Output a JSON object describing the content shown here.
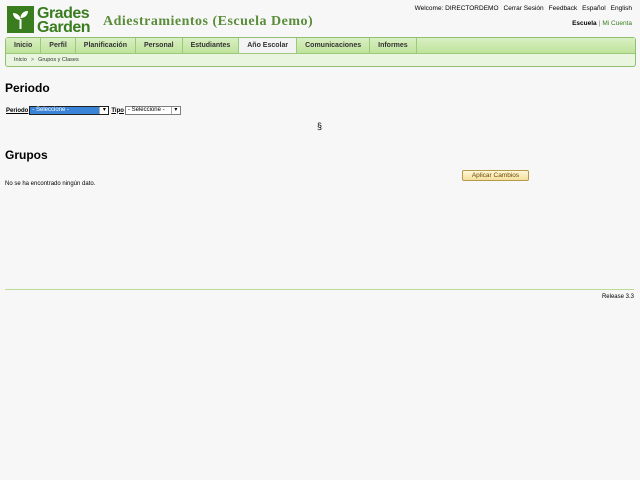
{
  "header": {
    "logo": {
      "line1": "Grades",
      "line2": "Garden"
    },
    "title": "Adiestramientos (Escuela Demo)",
    "top_links": {
      "welcome": "Welcome: DIRECTORDEMO",
      "logout": "Cerrar Sesión",
      "feedback": "Feedback",
      "spanish": "Español",
      "english": "English"
    },
    "scope": {
      "active": "Escuela",
      "separator": "|",
      "other": "Mi Cuenta"
    }
  },
  "nav": {
    "items": [
      {
        "label": "Inicio"
      },
      {
        "label": "Perfil"
      },
      {
        "label": "Planificación"
      },
      {
        "label": "Personal"
      },
      {
        "label": "Estudiantes"
      },
      {
        "label": "Año Escolar"
      },
      {
        "label": "Comunicaciones"
      },
      {
        "label": "Informes"
      }
    ],
    "active_index": 5
  },
  "breadcrumb": {
    "home": "Inicio",
    "separator": ">",
    "current": "Grupos y Clases"
  },
  "periodo_section": {
    "heading": "Periodo",
    "periodo_label": "Periodo",
    "periodo_value": "- Seleccione -",
    "tipo_label": "Tipo",
    "tipo_value": "- Seleccione -",
    "marker": "§"
  },
  "grupos_section": {
    "heading": "Grupos",
    "apply_button": "Aplicar Cambios",
    "empty_message": "No se ha encontrado ningún dato."
  },
  "footer": {
    "release": "Release 3.3"
  },
  "colors": {
    "brand_green": "#3a7d1e",
    "nav_green": "#bfe39b",
    "selection_blue": "#3a84d8"
  },
  "icons": {
    "logo": "sprout-icon",
    "dropdown": "chevron-down-icon"
  }
}
